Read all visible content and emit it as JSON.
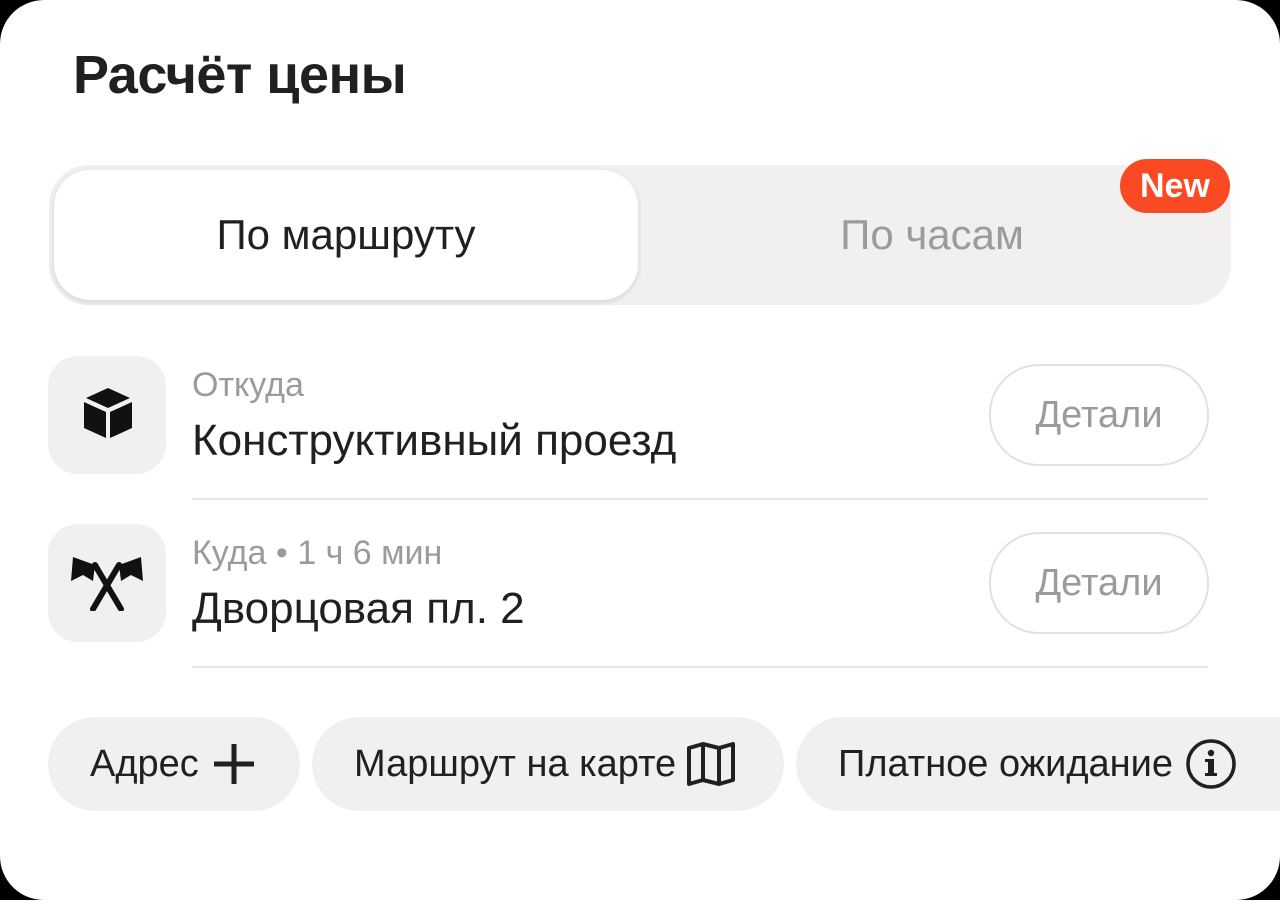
{
  "header": {
    "title": "Расчёт цены"
  },
  "mode_switch": {
    "tabs": [
      {
        "label": "По маршруту",
        "selected": true
      },
      {
        "label": "По часам",
        "selected": false
      }
    ],
    "badge": "New"
  },
  "route": {
    "from": {
      "label": "Откуда",
      "value": "Конструктивный проезд",
      "icon": "box-icon",
      "button": "Детали"
    },
    "to": {
      "label": "Куда • 1 ч 6 мин",
      "value": "Дворцовая пл. 2",
      "icon": "flags-icon",
      "button": "Детали"
    }
  },
  "actions": [
    {
      "label": "Адрес",
      "icon": "plus-icon"
    },
    {
      "label": "Маршрут на карте",
      "icon": "map-icon"
    },
    {
      "label": "Платное ожидание",
      "icon": "info-icon"
    }
  ],
  "colors": {
    "accent": "#fa4a24",
    "chip_bg": "#f1f0ee",
    "text": "#21201f",
    "muted": "#9c9b99"
  }
}
